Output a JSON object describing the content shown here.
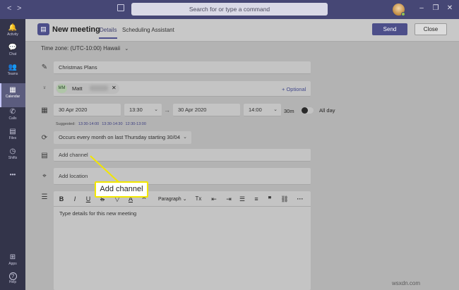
{
  "titlebar": {
    "back": "<",
    "forward": ">",
    "search_placeholder": "Search for or type a command",
    "minimize": "–",
    "maximize": "❐",
    "close": "✕"
  },
  "rail": {
    "items": [
      {
        "label": "Activity",
        "icon": "bell-icon",
        "glyph": "🔔"
      },
      {
        "label": "Chat",
        "icon": "chat-icon",
        "glyph": "💬"
      },
      {
        "label": "Teams",
        "icon": "teams-icon",
        "glyph": "👥"
      },
      {
        "label": "Calendar",
        "icon": "calendar-icon",
        "glyph": "▦"
      },
      {
        "label": "Calls",
        "icon": "phone-icon",
        "glyph": "✆"
      },
      {
        "label": "Files",
        "icon": "file-icon",
        "glyph": "▤"
      },
      {
        "label": "Shifts",
        "icon": "clock-icon",
        "glyph": "◷"
      },
      {
        "label": "",
        "icon": "more-icon",
        "glyph": "•••"
      }
    ],
    "bottom": [
      {
        "label": "Apps",
        "icon": "apps-icon",
        "glyph": "⊞"
      },
      {
        "label": "Help",
        "icon": "help-icon",
        "glyph": "?"
      }
    ]
  },
  "header": {
    "title": "New meeting",
    "tabs": [
      {
        "label": "Details"
      },
      {
        "label": "Scheduling Assistant"
      }
    ],
    "send_label": "Send",
    "close_label": "Close",
    "accent": "#4d4f8a"
  },
  "timezone": "Time zone: (UTC-10:00) Hawaii",
  "form": {
    "title_value": "Christmas Plans",
    "attendee": {
      "initials": "MM",
      "name": "Matt"
    },
    "optional_label": "+ Optional",
    "start_date": "30 Apr 2020",
    "start_time": "13:30",
    "end_date": "30 Apr 2020",
    "end_time": "14:00",
    "duration": "30m",
    "all_day_label": "All day",
    "suggested_label": "Suggested:",
    "suggested_times": [
      "13:30-14:00",
      "13:30-14:30",
      "12:30-13:00"
    ],
    "recurrence": "Occurs every month on last Thursday starting 30/04",
    "channel_placeholder": "Add channel",
    "location_placeholder": "Add location",
    "details_placeholder": "Type details for this new meeting"
  },
  "editor_toolbar": {
    "bold": "B",
    "italic": "I",
    "underline": "U",
    "strike": "S",
    "highlight": "▽",
    "font_color": "A",
    "font_size": "A",
    "paragraph": "Paragraph",
    "clear": "Tx",
    "outdent": "⇤",
    "indent": "⇥",
    "bullets": "☰",
    "numbers": "≡",
    "quote": "❞",
    "link": "⛓",
    "more": "···"
  },
  "callout": {
    "text": "Add channel",
    "color": "#f2e600"
  },
  "watermark": "wsxdn.com"
}
